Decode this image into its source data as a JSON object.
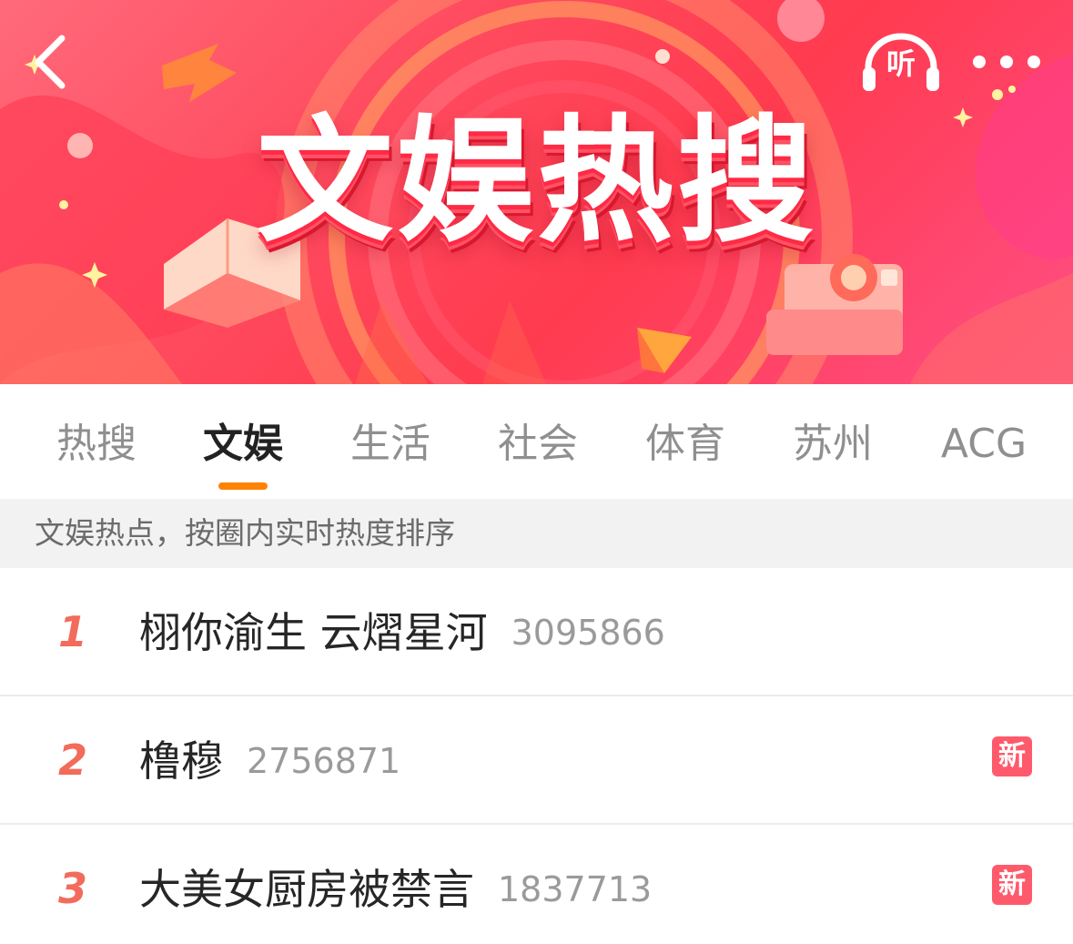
{
  "header": {
    "banner_title": "文娱热搜",
    "listen_label": "听"
  },
  "tabs": [
    {
      "label": "热搜",
      "active": false
    },
    {
      "label": "文娱",
      "active": true
    },
    {
      "label": "生活",
      "active": false
    },
    {
      "label": "社会",
      "active": false
    },
    {
      "label": "体育",
      "active": false
    },
    {
      "label": "苏州",
      "active": false
    },
    {
      "label": "ACG",
      "active": false
    }
  ],
  "subtitle": "文娱热点，按圈内实时热度排序",
  "list": [
    {
      "rank": "1",
      "title": "栩你渝生 云熠星河",
      "count": "3095866",
      "badge": ""
    },
    {
      "rank": "2",
      "title": "橹穆",
      "count": "2756871",
      "badge": "新"
    },
    {
      "rank": "3",
      "title": "大美女厨房被禁言",
      "count": "1837713",
      "badge": "新"
    }
  ],
  "colors": {
    "banner": "#ff4a5e",
    "tab_indicator": "#ff8200",
    "rank": "#f26b5b",
    "new_badge": "#ff5a6c"
  },
  "icons": {
    "back": "chevron-left-icon",
    "listen": "headphones-icon",
    "more": "more-dots-icon"
  }
}
